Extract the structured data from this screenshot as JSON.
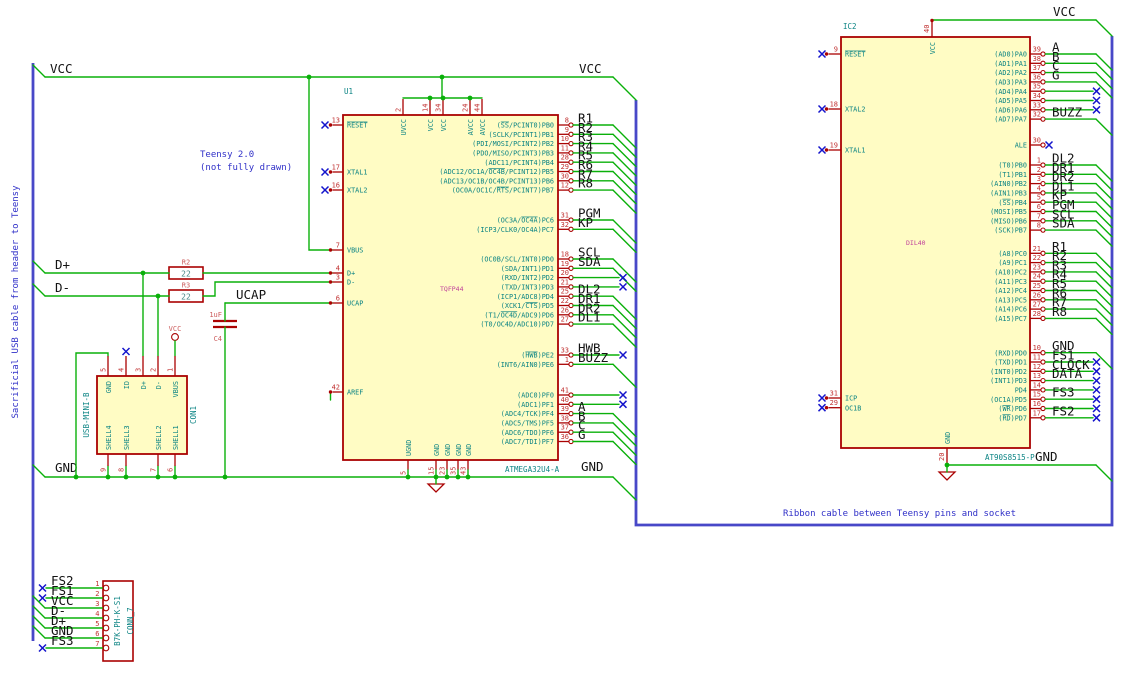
{
  "notes": {
    "left_cable": "Sacrificial USB cable from header to Teensy",
    "teensy_line1": "Teensy 2.0",
    "teensy_line2": "(not fully drawn)",
    "ribbon_cable": "Ribbon cable between Teensy pins and socket"
  },
  "labels": {
    "vcc": "VCC",
    "gnd": "GND",
    "dplus": "D+",
    "dminus": "D-",
    "ucap": "UCAP"
  },
  "components": {
    "u1": {
      "ref": "U1",
      "value": "ATMEGA32U4-A",
      "footprint": "TQFP44",
      "top_pins": [
        {
          "num": "2",
          "name": "UVCC"
        },
        {
          "num": "14",
          "name": "VCC"
        },
        {
          "num": "34",
          "name": "VCC"
        },
        {
          "num": "24",
          "name": "AVCC"
        },
        {
          "num": "44",
          "name": "AVCC"
        }
      ],
      "bottom_pins": [
        {
          "num": "5",
          "name": "UGND"
        },
        {
          "num": "15",
          "name": "GND"
        },
        {
          "num": "23",
          "name": "GND"
        },
        {
          "num": "35",
          "name": "GND"
        },
        {
          "num": "43",
          "name": "GND"
        }
      ],
      "left_pins": [
        {
          "num": "13",
          "name": "~RESET~",
          "conn": "nc"
        },
        {
          "num": "17",
          "name": "XTAL1",
          "conn": "nc"
        },
        {
          "num": "16",
          "name": "XTAL2",
          "conn": "nc"
        },
        {
          "num": "7",
          "name": "VBUS",
          "conn": "wire"
        },
        {
          "num": "4",
          "name": "D+",
          "conn": "wire"
        },
        {
          "num": "3",
          "name": "D-",
          "conn": "wire"
        },
        {
          "num": "6",
          "name": "UCAP",
          "conn": "wire"
        },
        {
          "num": "42",
          "name": "AREF",
          "conn": "stub"
        }
      ],
      "right_pins": [
        {
          "num": "8",
          "name": "(~SS~/PCINT0)PB0",
          "label": "R1",
          "conn": "bus"
        },
        {
          "num": "9",
          "name": "(SCLK/PCINT1)PB1",
          "label": "R2",
          "conn": "bus"
        },
        {
          "num": "10",
          "name": "(PDI/MOSI/PCINT2)PB2",
          "label": "R3",
          "conn": "bus"
        },
        {
          "num": "11",
          "name": "(PDO/MISO/PCINT3)PB3",
          "label": "R4",
          "conn": "bus"
        },
        {
          "num": "28",
          "name": "(ADC11/PCINT4)PB4",
          "label": "R5",
          "conn": "bus"
        },
        {
          "num": "29",
          "name": "(ADC12/OC1A/~OC4B~/PCINT12)PB5",
          "label": "R6",
          "conn": "bus"
        },
        {
          "num": "30",
          "name": "(ADC13/OC1B/OC4B/PCINT13)PB6",
          "label": "R7",
          "conn": "bus"
        },
        {
          "num": "12",
          "name": "(OC0A/OC1C/~RTS~/PCINT7)PB7",
          "label": "R8",
          "conn": "bus"
        },
        {
          "num": "31",
          "name": "(OC3A/~OC4A~)PC6",
          "label": "PGM",
          "conn": "bus"
        },
        {
          "num": "32",
          "name": "(ICP3/CLK0/OC4A)PC7",
          "label": "KP",
          "conn": "bus"
        },
        {
          "num": "18",
          "name": "(OC0B/SCL/INT0)PD0",
          "label": "SCL",
          "conn": "bus"
        },
        {
          "num": "19",
          "name": "(SDA/INT1)PD1",
          "label": "SDA",
          "conn": "bus"
        },
        {
          "num": "20",
          "name": "(RXD/INT2)PD2",
          "label": "",
          "conn": "nc"
        },
        {
          "num": "21",
          "name": "(TXD/INT3)PD3",
          "label": "",
          "conn": "nc"
        },
        {
          "num": "25",
          "name": "(ICP1/ADC8)PD4",
          "label": "DL2",
          "conn": "bus"
        },
        {
          "num": "22",
          "name": "(XCK1/~CTS~)PD5",
          "label": "DR1",
          "conn": "bus"
        },
        {
          "num": "26",
          "name": "(T1/~OC4D~/ADC9)PD6",
          "label": "DR2",
          "conn": "bus"
        },
        {
          "num": "27",
          "name": "(T0/OC4D/ADC10)PD7",
          "label": "DL1",
          "conn": "bus"
        },
        {
          "num": "33",
          "name": "(~HWB~)PE2",
          "label": "HWB",
          "conn": "nc"
        },
        {
          "num": "1",
          "name": "(INT6/AIN0)PE6",
          "label": "BUZZ",
          "conn": "bus"
        },
        {
          "num": "41",
          "name": "(ADC0)PF0",
          "label": "",
          "conn": "nc"
        },
        {
          "num": "40",
          "name": "(ADC1)PF1",
          "label": "",
          "conn": "nc"
        },
        {
          "num": "39",
          "name": "(ADC4/TCK)PF4",
          "label": "A",
          "conn": "bus"
        },
        {
          "num": "38",
          "name": "(ADC5/TMS)PF5",
          "label": "B",
          "conn": "bus"
        },
        {
          "num": "37",
          "name": "(ADC6/TDO)PF6",
          "label": "C",
          "conn": "bus"
        },
        {
          "num": "36",
          "name": "(ADC7/TDI)PF7",
          "label": "G",
          "conn": "bus"
        }
      ]
    },
    "ic2": {
      "ref": "IC2",
      "value": "AT90S8515-P",
      "footprint": "DIL40",
      "top_pins": [
        {
          "num": "40",
          "name": "VCC"
        }
      ],
      "bottom_pins": [
        {
          "num": "20",
          "name": "GND"
        }
      ],
      "left_pins": [
        {
          "num": "9",
          "name": "~RESET~",
          "conn": "nc"
        },
        {
          "num": "18",
          "name": "XTAL2",
          "conn": "nc"
        },
        {
          "num": "19",
          "name": "XTAL1",
          "conn": "nc"
        },
        {
          "num": "31",
          "name": "ICP",
          "conn": "nc"
        },
        {
          "num": "29",
          "name": "OC1B",
          "conn": "nc"
        }
      ],
      "right_pins": [
        {
          "num": "39",
          "name": "(AD0)PA0",
          "label": "A",
          "conn": "bus"
        },
        {
          "num": "38",
          "name": "(AD1)PA1",
          "label": "B",
          "conn": "bus"
        },
        {
          "num": "37",
          "name": "(AD2)PA2",
          "label": "C",
          "conn": "bus"
        },
        {
          "num": "36",
          "name": "(AD3)PA3",
          "label": "G",
          "conn": "bus"
        },
        {
          "num": "35",
          "name": "(AD4)PA4",
          "label": "",
          "conn": "nc"
        },
        {
          "num": "34",
          "name": "(AD5)PA5",
          "label": "",
          "conn": "nc"
        },
        {
          "num": "33",
          "name": "(AD6)PA6",
          "label": "",
          "conn": "nc"
        },
        {
          "num": "32",
          "name": "(AD7)PA7",
          "label": "BUZZ",
          "conn": "bus"
        },
        {
          "num": "30",
          "name": "ALE",
          "label": "",
          "conn": "ncpin"
        },
        {
          "num": "1",
          "name": "(T0)PB0",
          "label": "DL2",
          "conn": "bus"
        },
        {
          "num": "2",
          "name": "(T1)PB1",
          "label": "DR1",
          "conn": "bus"
        },
        {
          "num": "3",
          "name": "(AIN0)PB2",
          "label": "DR2",
          "conn": "bus"
        },
        {
          "num": "4",
          "name": "(AIN1)PB3",
          "label": "DL1",
          "conn": "bus"
        },
        {
          "num": "5",
          "name": "(~SS~)PB4",
          "label": "KP",
          "conn": "bus"
        },
        {
          "num": "6",
          "name": "(MOSI)PB5",
          "label": "PGM",
          "conn": "bus"
        },
        {
          "num": "7",
          "name": "(MISO)PB6",
          "label": "SCL",
          "conn": "bus"
        },
        {
          "num": "8",
          "name": "(SCK)PB7",
          "label": "SDA",
          "conn": "bus"
        },
        {
          "num": "21",
          "name": "(A8)PC0",
          "label": "R1",
          "conn": "bus"
        },
        {
          "num": "22",
          "name": "(A9)PC1",
          "label": "R2",
          "conn": "bus"
        },
        {
          "num": "23",
          "name": "(A10)PC2",
          "label": "R3",
          "conn": "bus"
        },
        {
          "num": "24",
          "name": "(A11)PC3",
          "label": "R4",
          "conn": "bus"
        },
        {
          "num": "25",
          "name": "(A12)PC4",
          "label": "R5",
          "conn": "bus"
        },
        {
          "num": "26",
          "name": "(A13)PC5",
          "label": "R6",
          "conn": "bus"
        },
        {
          "num": "27",
          "name": "(A14)PC6",
          "label": "R7",
          "conn": "bus"
        },
        {
          "num": "28",
          "name": "(A15)PC7",
          "label": "R8",
          "conn": "bus"
        },
        {
          "num": "10",
          "name": "(RXD)PD0",
          "label": "GND",
          "conn": "bus"
        },
        {
          "num": "11",
          "name": "(TXD)PD1",
          "label": "FS1",
          "conn": "nc"
        },
        {
          "num": "12",
          "name": "(INT0)PD2",
          "label": "CLOCK",
          "conn": "nc"
        },
        {
          "num": "13",
          "name": "(INT1)PD3",
          "label": "DATA",
          "conn": "nc"
        },
        {
          "num": "14",
          "name": "PD4",
          "label": "",
          "conn": "nc"
        },
        {
          "num": "15",
          "name": "(OC1A)PD5",
          "label": "FS3",
          "conn": "nc"
        },
        {
          "num": "16",
          "name": "(~WR~)PD6",
          "label": "",
          "conn": "nc"
        },
        {
          "num": "17",
          "name": "(~RD~)PD7",
          "label": "FS2",
          "conn": "nc"
        }
      ]
    },
    "usb": {
      "ref": "CON1",
      "value": "USB-MINI-B",
      "top_pins": [
        {
          "num": "5",
          "name": "GND"
        },
        {
          "num": "4",
          "name": "ID"
        },
        {
          "num": "3",
          "name": "D+"
        },
        {
          "num": "2",
          "name": "D-"
        },
        {
          "num": "1",
          "name": "VBUS"
        }
      ],
      "bottom_pins": [
        {
          "num": "9",
          "name": "SHELL4"
        },
        {
          "num": "8",
          "name": "SHELL3"
        },
        {
          "num": "7",
          "name": "SHELL2"
        },
        {
          "num": "6",
          "name": "SHELL1"
        }
      ]
    },
    "conn7": {
      "ref": "CONN_7",
      "value": "B7K-PH-K-S1",
      "rows": [
        {
          "num": "1",
          "label": "FS2",
          "conn": "nc"
        },
        {
          "num": "2",
          "label": "FS1",
          "conn": "nc"
        },
        {
          "num": "3",
          "label": "VCC",
          "conn": "bus"
        },
        {
          "num": "4",
          "label": "D-",
          "conn": "bus"
        },
        {
          "num": "5",
          "label": "D+",
          "conn": "bus"
        },
        {
          "num": "6",
          "label": "GND",
          "conn": "bus"
        },
        {
          "num": "7",
          "label": "FS3",
          "conn": "nc"
        }
      ]
    },
    "r2": {
      "ref": "R2",
      "value": "22"
    },
    "r3": {
      "ref": "R3",
      "value": "22"
    },
    "c4": {
      "ref": "C4",
      "value": "1uF"
    },
    "vcc_port": {
      "label": "VCC"
    }
  },
  "colors": {
    "wire": "#0ab00a",
    "bus": "#4848c8",
    "component": "#aa0202",
    "fill": "#fffcc4",
    "pin_name": "#0c8484",
    "pin_number": "#c03030",
    "net_label": "#141414",
    "note": "#3030c8",
    "no_connect": "#1414cc"
  }
}
